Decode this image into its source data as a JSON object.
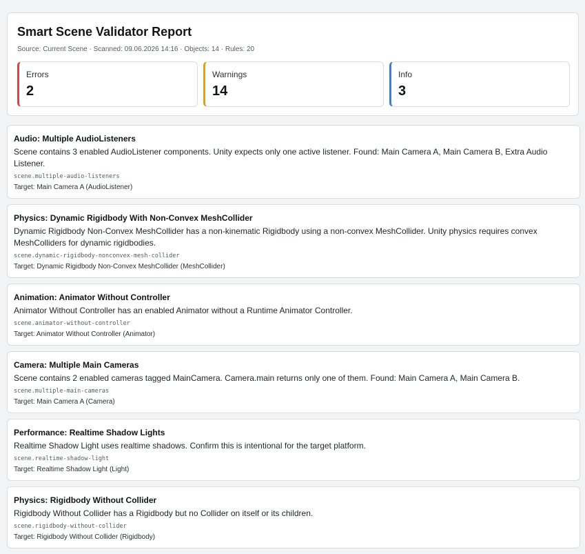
{
  "report": {
    "title": "Smart Scene Validator Report",
    "meta": "Source: Current Scene · Scanned: 09.06.2026 14:16 · Objects: 14 · Rules: 20"
  },
  "stats": [
    {
      "label": "Errors",
      "value": "2",
      "color": "#d64545"
    },
    {
      "label": "Warnings",
      "value": "14",
      "color": "#d9a21f"
    },
    {
      "label": "Info",
      "value": "3",
      "color": "#3f7fd1"
    }
  ],
  "issues": [
    {
      "title": "Audio: Multiple AudioListeners",
      "description": "Scene contains 3 enabled AudioListener components. Unity expects only one active listener. Found: Main Camera A, Main Camera B, Extra Audio Listener.",
      "rule": "scene.multiple-audio-listeners",
      "target": "Target: Main Camera A (AudioListener)"
    },
    {
      "title": "Physics: Dynamic Rigidbody With Non-Convex MeshCollider",
      "description": "Dynamic Rigidbody Non-Convex MeshCollider has a non-kinematic Rigidbody using a non-convex MeshCollider. Unity physics requires convex MeshColliders for dynamic rigidbodies.",
      "rule": "scene.dynamic-rigidbody-nonconvex-mesh-collider",
      "target": "Target: Dynamic Rigidbody Non-Convex MeshCollider (MeshCollider)"
    },
    {
      "title": "Animation: Animator Without Controller",
      "description": "Animator Without Controller has an enabled Animator without a Runtime Animator Controller.",
      "rule": "scene.animator-without-controller",
      "target": "Target: Animator Without Controller (Animator)"
    },
    {
      "title": "Camera: Multiple Main Cameras",
      "description": "Scene contains 2 enabled cameras tagged MainCamera. Camera.main returns only one of them. Found: Main Camera A, Main Camera B.",
      "rule": "scene.multiple-main-cameras",
      "target": "Target: Main Camera A (Camera)"
    },
    {
      "title": "Performance: Realtime Shadow Lights",
      "description": "Realtime Shadow Light uses realtime shadows. Confirm this is intentional for the target platform.",
      "rule": "scene.realtime-shadow-light",
      "target": "Target: Realtime Shadow Light (Light)"
    },
    {
      "title": "Physics: Rigidbody Without Collider",
      "description": "Rigidbody Without Collider has a Rigidbody but no Collider on itself or its children.",
      "rule": "scene.rigidbody-without-collider",
      "target": "Target: Rigidbody Without Collider (Rigidbody)"
    }
  ]
}
